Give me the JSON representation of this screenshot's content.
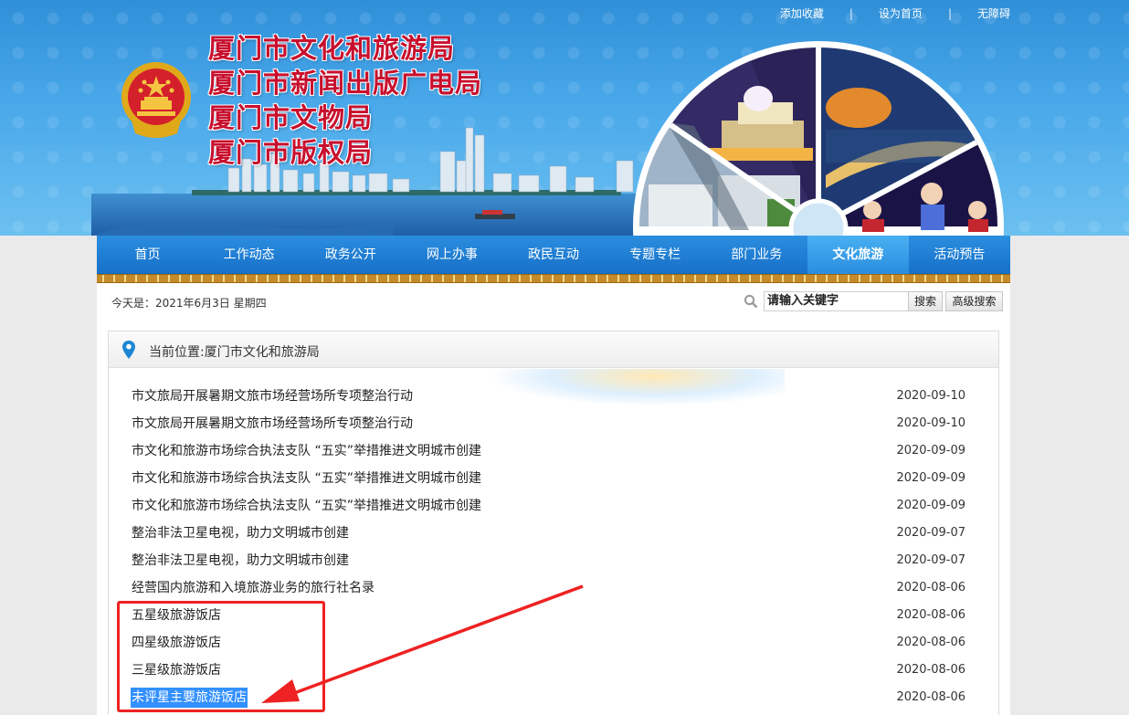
{
  "top_links": [
    "添加收藏",
    "设为首页",
    "无障碍"
  ],
  "top_separator": "|",
  "agency_titles": [
    "厦门市文化和旅游局",
    "厦门市新闻出版广电局",
    "厦门市文物局",
    "厦门市版权局"
  ],
  "nav": {
    "items": [
      "首页",
      "工作动态",
      "政务公开",
      "网上办事",
      "政民互动",
      "专题专栏",
      "部门业务",
      "文化旅游",
      "活动预告"
    ],
    "active": "文化旅游"
  },
  "date_bar": {
    "today": "今天是：2021年6月3日  星期四"
  },
  "search": {
    "value": "请输入关键字",
    "button": "搜索",
    "advanced": "高级搜索"
  },
  "breadcrumb": "当前位置:厦门市文化和旅游局",
  "articles": [
    {
      "title": "市文旅局开展暑期文旅市场经营场所专项整治行动",
      "date": "2020-09-10"
    },
    {
      "title": "市文旅局开展暑期文旅市场经营场所专项整治行动",
      "date": "2020-09-10"
    },
    {
      "title": "市文化和旅游市场综合执法支队  “五实”举措推进文明城市创建",
      "date": "2020-09-09"
    },
    {
      "title": "市文化和旅游市场综合执法支队  “五实”举措推进文明城市创建",
      "date": "2020-09-09"
    },
    {
      "title": "市文化和旅游市场综合执法支队  “五实”举措推进文明城市创建",
      "date": "2020-09-09"
    },
    {
      "title": "整治非法卫星电视，助力文明城市创建",
      "date": "2020-09-07"
    },
    {
      "title": "整治非法卫星电视，助力文明城市创建",
      "date": "2020-09-07"
    },
    {
      "title": "经营国内旅游和入境旅游业务的旅行社名录",
      "date": "2020-08-06"
    },
    {
      "title": "五星级旅游饭店",
      "date": "2020-08-06"
    },
    {
      "title": "四星级旅游饭店",
      "date": "2020-08-06"
    },
    {
      "title": "三星级旅游饭店",
      "date": "2020-08-06"
    },
    {
      "title": "未评星主要旅游饭店",
      "date": "2020-08-06",
      "selected": true
    }
  ],
  "colors": {
    "nav_blue": "#1670c8",
    "title_red": "#c8102e",
    "highlight_box": "#ee2222",
    "selection": "#3390ff"
  },
  "icons": [
    "national-emblem-icon",
    "search-icon",
    "location-pin-icon",
    "annotation-arrow"
  ]
}
